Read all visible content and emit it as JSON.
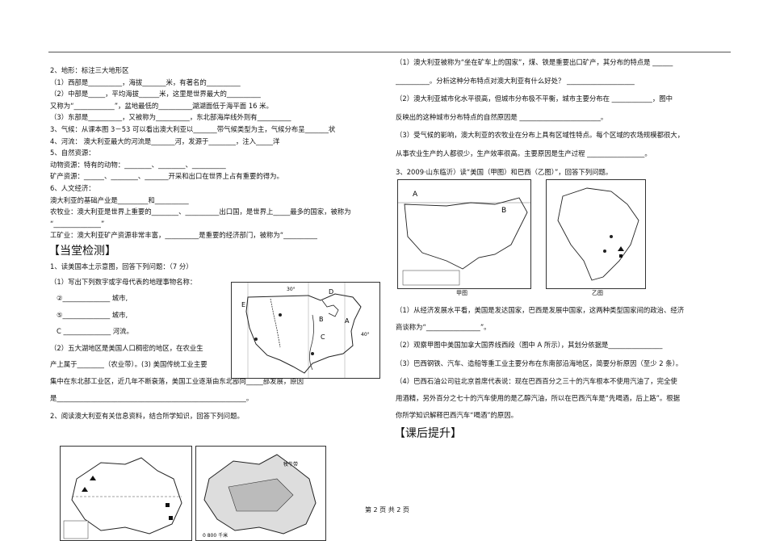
{
  "left": {
    "q2_title": "2、地形：标注三大地形区",
    "q2_1": "（1）西部是__________，海拔_______米，有著名的__________",
    "q2_2": "（2）中部是_____，平均海拔______米，这里是世界最大的__________",
    "q2_2b": "又称为“____________”，盆地最低的__________湖湖面低于海平面 16 米。",
    "q2_3": "（3）东部是__________，又被称为__________，东北部海岸线外则有__________",
    "q3": "3、气候：从课本图 3－53 可以看出澳大利亚以_______带气候类型为主，气候分布呈_______状",
    "q4": "4、河流：  澳大利亚最大的河流是_______河，发源于________，注入_____洋",
    "q5": "5、自然资源：",
    "q5_animals": "动物资源：特有的动物：________、________、__________",
    "q5_minerals": "矿产资源：______、________、_______开采和出口在世界上占有重要的得为。",
    "q6": "6、人文经济：",
    "q6_base": "澳大利亚的基础产业是_________和__________",
    "q6_agri": "农牧业：澳大利亚是世界上重要的________、__________出口国，是世界上_____最多的国家，被称为",
    "q6_agri2": "“______________”",
    "q6_mining": "工矿业：澳大利亚矿产资源非常丰富，__________是重要的经济部门，被称为“__________",
    "section_check": "【当堂检测】",
    "t1": "1、读美国本土示意图，回答下列问题：（7 分）",
    "t1_1": "（1）写出下列数字或字母代表的地理事物名称：",
    "t1_a": "②______________ 城市,",
    "t1_b": "⑤______________ 城市,",
    "t1_c": "C  ______________ 河流。",
    "t1_2": "（2）五大湖地区是美国人口稠密的地区，在农业生",
    "t1_2b": "产上属于________（农业带）。(3) 美国传统工业主要",
    "t1_2c": "集中在东北部工业区，近几年不断衰落，美国工业逐渐由东北部向_____部发展，原因",
    "t1_2d": "是________________________________________________________。",
    "t2": "2、阅读澳大利亚有关信息资料，结合所学知识，回答下列问题。"
  },
  "right": {
    "r1": "（1）澳大利亚被称为“坐在矿车上的国家”，煤、铁是重要出口矿产，其分布的特点是 ______",
    "r1b": "__________。分析这种分布特点对澳大利亚有什么好处？ ____________________",
    "r2": "（2）澳大利亚城市化水平很高，但城市分布极不平衡，城市主要分布在 ____________，图中",
    "r2b": "反映出的这种城市分布特点的自然原因是 ________________________。",
    "r3": "（3）受气候的影响，澳大利亚的农牧业在分布上具有区域性特点。每个区域的农场规模都很大，",
    "r3b": "从事农业生产的人都很少，生产效率很高。主要原因是生产过程 _________________。",
    "r_q3": "3、2009·山东临沂）读“美国（甲图）和巴西（乙图）”，回答下列问题。",
    "fig_a_label": "甲图",
    "fig_b_label": "乙图",
    "s1": "（1）从经济发展水平看，美国是发达国家，巴西是发展中国家，这两种类型国家间的政治、经济",
    "s1b": "商谈称为“________________”。",
    "s2": "（2）观察甲图中美国加拿大国界线西段（图中 A 所示），其划分依据是________________",
    "s3": "（3）巴西钢铁、汽车、造船等重工业主要分布在东南部沿海地区，简要分析原因（至少 2 条）。",
    "s4": "（4）巴西石油公司驻北京首席代表说：现在巴西百分之三十的汽车根本不使用汽油了，完全使",
    "s4b": "用酒精，另外百分之七十的汽车使用的是乙醇汽油，所以在巴西汽车是“先喝酒，后上路”。根据",
    "s4c": "你所学知识解释巴西汽车“喝酒”的原因。",
    "section_after": "【课后提升】"
  },
  "map_labels": {
    "us_e": "E",
    "us_d": "D",
    "us_a": "A",
    "us_b": "B",
    "us_c": "C",
    "us_deg1": "30°",
    "us_deg2": "40°",
    "au_legend": "牧牛带",
    "au_scale": "0    800 千米"
  },
  "footer": "第 2 页 共 2 页"
}
